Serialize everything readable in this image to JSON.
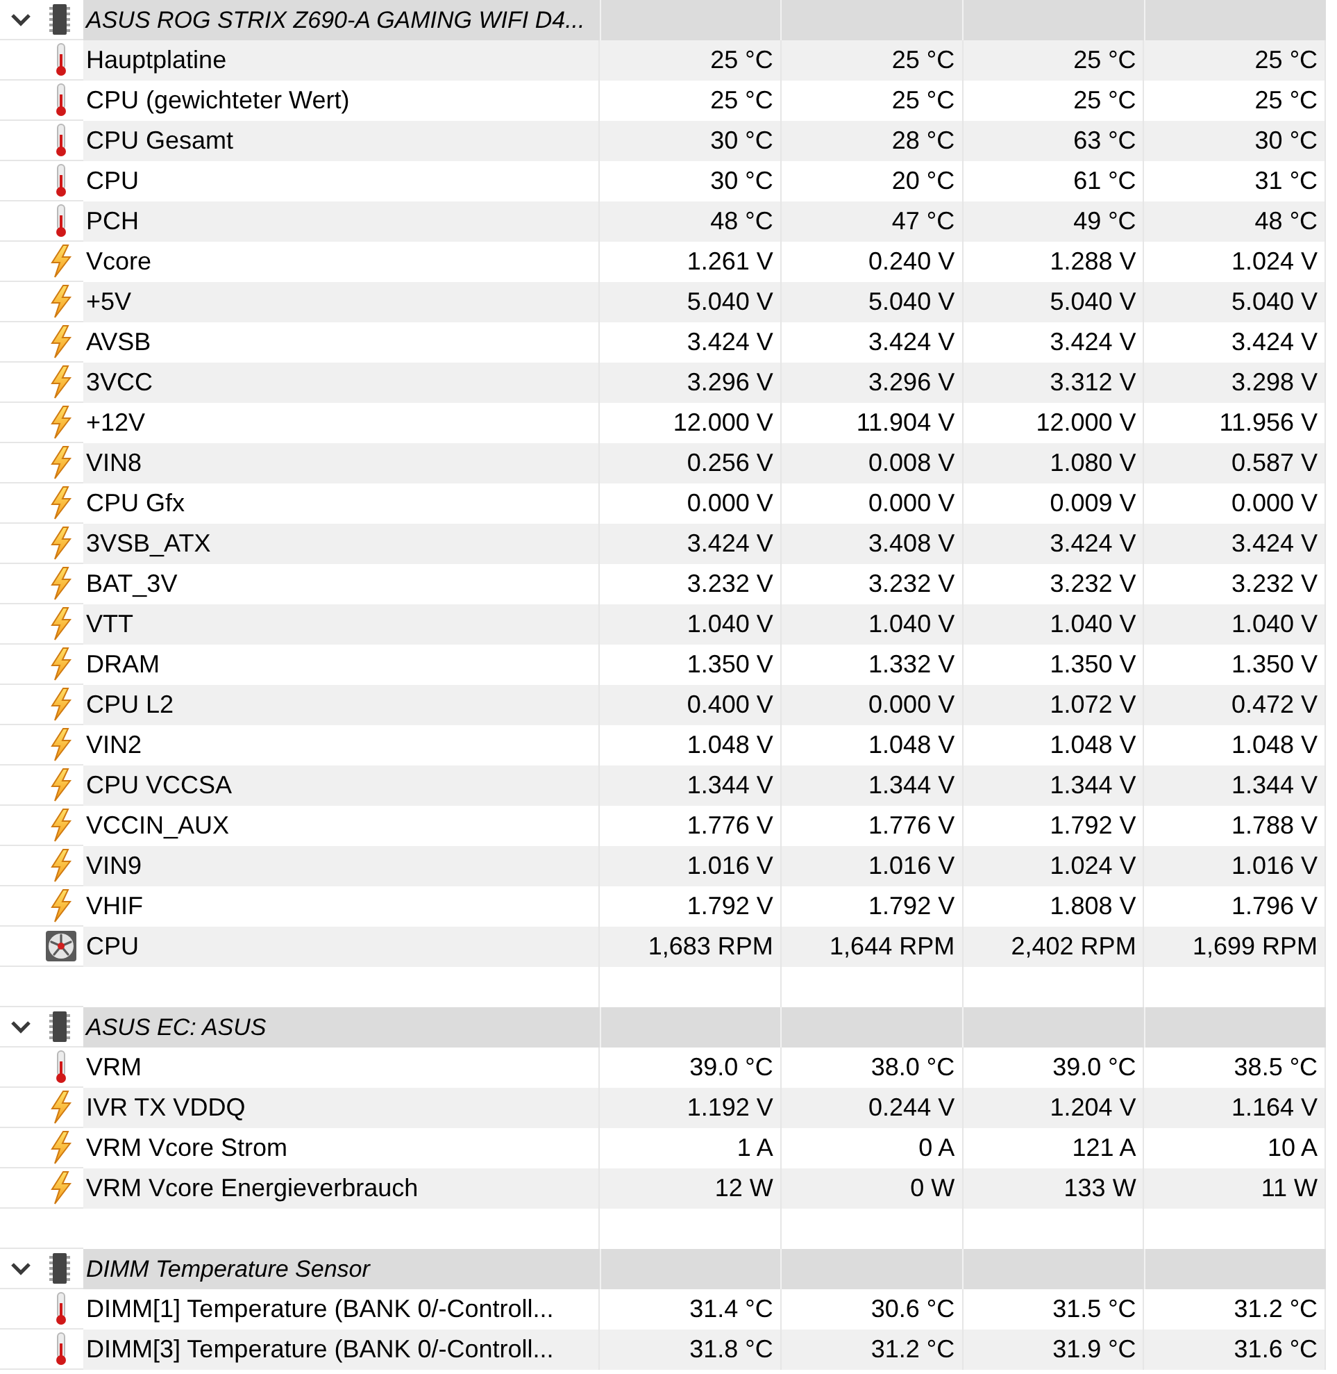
{
  "groups": [
    {
      "title": "ASUS ROG STRIX Z690-A GAMING WIFI D4...",
      "expanded": true,
      "sensors": [
        {
          "kind": "temperature",
          "name": "Hauptplatine",
          "values": [
            "25 °C",
            "25 °C",
            "25 °C",
            "25 °C"
          ]
        },
        {
          "kind": "temperature",
          "name": "CPU (gewichteter Wert)",
          "values": [
            "25 °C",
            "25 °C",
            "25 °C",
            "25 °C"
          ]
        },
        {
          "kind": "temperature",
          "name": "CPU Gesamt",
          "values": [
            "30 °C",
            "28 °C",
            "63 °C",
            "30 °C"
          ]
        },
        {
          "kind": "temperature",
          "name": "CPU",
          "values": [
            "30 °C",
            "20 °C",
            "61 °C",
            "31 °C"
          ]
        },
        {
          "kind": "temperature",
          "name": "PCH",
          "values": [
            "48 °C",
            "47 °C",
            "49 °C",
            "48 °C"
          ]
        },
        {
          "kind": "voltage",
          "name": "Vcore",
          "values": [
            "1.261 V",
            "0.240 V",
            "1.288 V",
            "1.024 V"
          ]
        },
        {
          "kind": "voltage",
          "name": "+5V",
          "values": [
            "5.040 V",
            "5.040 V",
            "5.040 V",
            "5.040 V"
          ]
        },
        {
          "kind": "voltage",
          "name": "AVSB",
          "values": [
            "3.424 V",
            "3.424 V",
            "3.424 V",
            "3.424 V"
          ]
        },
        {
          "kind": "voltage",
          "name": "3VCC",
          "values": [
            "3.296 V",
            "3.296 V",
            "3.312 V",
            "3.298 V"
          ]
        },
        {
          "kind": "voltage",
          "name": "+12V",
          "values": [
            "12.000 V",
            "11.904 V",
            "12.000 V",
            "11.956 V"
          ]
        },
        {
          "kind": "voltage",
          "name": "VIN8",
          "values": [
            "0.256 V",
            "0.008 V",
            "1.080 V",
            "0.587 V"
          ]
        },
        {
          "kind": "voltage",
          "name": "CPU Gfx",
          "values": [
            "0.000 V",
            "0.000 V",
            "0.009 V",
            "0.000 V"
          ]
        },
        {
          "kind": "voltage",
          "name": "3VSB_ATX",
          "values": [
            "3.424 V",
            "3.408 V",
            "3.424 V",
            "3.424 V"
          ]
        },
        {
          "kind": "voltage",
          "name": "BAT_3V",
          "values": [
            "3.232 V",
            "3.232 V",
            "3.232 V",
            "3.232 V"
          ]
        },
        {
          "kind": "voltage",
          "name": "VTT",
          "values": [
            "1.040 V",
            "1.040 V",
            "1.040 V",
            "1.040 V"
          ]
        },
        {
          "kind": "voltage",
          "name": "DRAM",
          "values": [
            "1.350 V",
            "1.332 V",
            "1.350 V",
            "1.350 V"
          ]
        },
        {
          "kind": "voltage",
          "name": "CPU L2",
          "values": [
            "0.400 V",
            "0.000 V",
            "1.072 V",
            "0.472 V"
          ]
        },
        {
          "kind": "voltage",
          "name": "VIN2",
          "values": [
            "1.048 V",
            "1.048 V",
            "1.048 V",
            "1.048 V"
          ]
        },
        {
          "kind": "voltage",
          "name": "CPU VCCSA",
          "values": [
            "1.344 V",
            "1.344 V",
            "1.344 V",
            "1.344 V"
          ]
        },
        {
          "kind": "voltage",
          "name": "VCCIN_AUX",
          "values": [
            "1.776 V",
            "1.776 V",
            "1.792 V",
            "1.788 V"
          ]
        },
        {
          "kind": "voltage",
          "name": "VIN9",
          "values": [
            "1.016 V",
            "1.016 V",
            "1.024 V",
            "1.016 V"
          ]
        },
        {
          "kind": "voltage",
          "name": "VHIF",
          "values": [
            "1.792 V",
            "1.792 V",
            "1.808 V",
            "1.796 V"
          ]
        },
        {
          "kind": "fan",
          "name": "CPU",
          "values": [
            "1,683 RPM",
            "1,644 RPM",
            "2,402 RPM",
            "1,699 RPM"
          ]
        }
      ]
    },
    {
      "title": "ASUS EC: ASUS",
      "expanded": true,
      "sensors": [
        {
          "kind": "temperature",
          "name": "VRM",
          "values": [
            "39.0 °C",
            "38.0 °C",
            "39.0 °C",
            "38.5 °C"
          ]
        },
        {
          "kind": "voltage",
          "name": "IVR TX VDDQ",
          "values": [
            "1.192 V",
            "0.244 V",
            "1.204 V",
            "1.164 V"
          ]
        },
        {
          "kind": "current",
          "name": "VRM Vcore Strom",
          "values": [
            "1 A",
            "0 A",
            "121 A",
            "10 A"
          ]
        },
        {
          "kind": "power",
          "name": "VRM Vcore Energieverbrauch",
          "values": [
            "12 W",
            "0 W",
            "133 W",
            "11 W"
          ]
        }
      ]
    },
    {
      "title": "DIMM Temperature Sensor",
      "expanded": true,
      "sensors": [
        {
          "kind": "temperature",
          "name": "DIMM[1] Temperature (BANK 0/-Controll...",
          "values": [
            "31.4 °C",
            "30.6 °C",
            "31.5 °C",
            "31.2 °C"
          ]
        },
        {
          "kind": "temperature",
          "name": "DIMM[3] Temperature (BANK 0/-Controll...",
          "values": [
            "31.8 °C",
            "31.2 °C",
            "31.9 °C",
            "31.6 °C"
          ]
        }
      ]
    }
  ]
}
